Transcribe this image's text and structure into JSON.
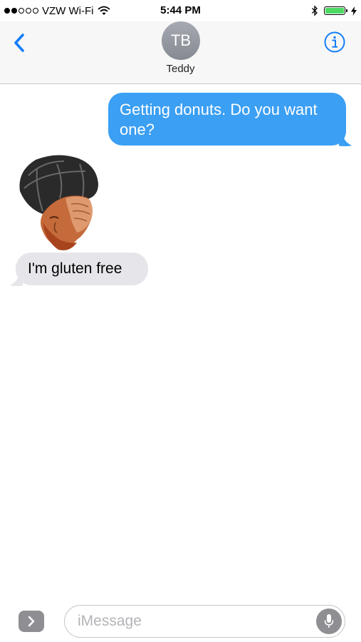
{
  "status_bar": {
    "carrier": "VZW Wi-Fi",
    "time": "5:44 PM",
    "signal_bars_filled": 2,
    "signal_bars_total": 5,
    "battery_color": "#4cd964"
  },
  "header": {
    "back_icon": "chevron-left-icon",
    "avatar_initials": "TB",
    "contact_name": "Teddy",
    "info_icon": "info-icon",
    "accent_color": "#147efb"
  },
  "messages": [
    {
      "direction": "outgoing",
      "text": "Getting donuts. Do you want one?",
      "color": "#3b9ff3"
    },
    {
      "direction": "incoming",
      "type": "sticker",
      "sticker": "facepalm-sticker"
    },
    {
      "direction": "incoming",
      "text": "I'm gluten free",
      "color": "#e5e5ea"
    }
  ],
  "input_bar": {
    "expand_icon": "chevron-right-icon",
    "placeholder": "iMessage",
    "mic_icon": "microphone-icon"
  }
}
